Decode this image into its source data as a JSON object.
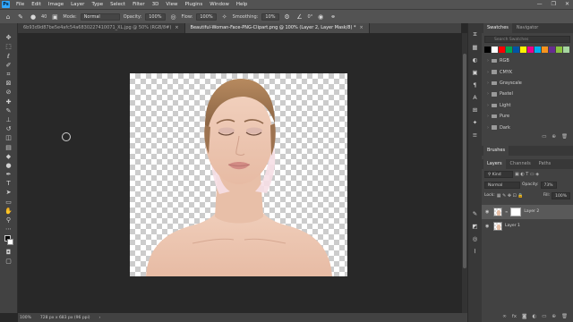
{
  "menubar": {
    "logo": "Ps",
    "items": [
      "File",
      "Edit",
      "Image",
      "Layer",
      "Type",
      "Select",
      "Filter",
      "3D",
      "View",
      "Plugins",
      "Window",
      "Help"
    ],
    "controls": [
      "—",
      "❐",
      "✕"
    ]
  },
  "options": {
    "mode_label": "Mode:",
    "mode_value": "Normal",
    "opacity_label": "Opacity:",
    "opacity_value": "100%",
    "flow_label": "Flow:",
    "flow_value": "100%",
    "smoothing_label": "Smoothing:",
    "smoothing_value": "10%",
    "angle_value": "0°",
    "brush_size": "40"
  },
  "tabs": [
    {
      "label": "6b93d9d87be5e4afc54a6830227410071_XL.jpg @ 50% (RGB/8#)",
      "active": false
    },
    {
      "label": "Beautiful-Woman-Face-PNG-Clipart.png @ 100% (Layer 2, Layer Mask/8) *",
      "active": true
    }
  ],
  "status": {
    "zoom": "100%",
    "doc_info": "728 px x 683 px (96 ppi)"
  },
  "swatches": {
    "tabs": [
      "Swatches",
      "Navigator"
    ],
    "search_placeholder": "Search Swatches",
    "colors": [
      "#000000",
      "#ffffff",
      "#ff0000",
      "#00a651",
      "#0054a6",
      "#fff200",
      "#ec008c",
      "#00aeef",
      "#f7941d",
      "#662d91",
      "#8dc63f",
      "#ed1c24",
      "#39b54a",
      "#0072bc",
      "#a6d6a0"
    ],
    "folders": [
      "RGB",
      "CMYK",
      "Grayscale",
      "Pastel",
      "Light",
      "Pure",
      "Dark"
    ]
  },
  "brushes": {
    "title": "Brushes"
  },
  "layers": {
    "tabs": [
      "Layers",
      "Channels",
      "Paths"
    ],
    "kind_label": "Kind",
    "blend_mode": "Normal",
    "opacity_label": "Opacity:",
    "opacity_value": "73%",
    "lock_label": "Lock:",
    "fill_label": "Fill:",
    "fill_value": "100%",
    "items": [
      {
        "name": "Layer 2",
        "selected": true,
        "has_mask": true
      },
      {
        "name": "Layer 1",
        "selected": false,
        "has_mask": false
      }
    ]
  }
}
